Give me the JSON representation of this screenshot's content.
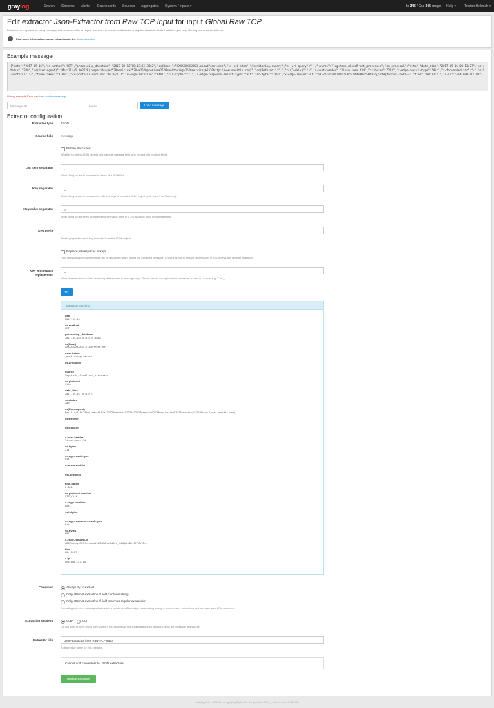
{
  "nav": {
    "logo_a": "gray",
    "logo_b": "log",
    "items": [
      "Search",
      "Streams",
      "Alerts",
      "Dashboards",
      "Sources",
      "Aggregates",
      "System / Inputs ▾"
    ],
    "throughput_prefix": "In",
    "throughput_in": "345",
    "throughput_mid": "/ Out",
    "throughput_out": "345",
    "throughput_unit": "msg/s",
    "help": "Help ▾",
    "user": "Tristan Helmich ▾"
  },
  "header": {
    "title_prefix": "Edit extractor ",
    "title_extractor": "Json-Extractor from Raw TCP Input",
    "title_mid": " for input ",
    "title_input": "Global Raw TCP",
    "subtitle": "Extractors are applied on every message that is received by an input. Use them to extract and transform any text data into fields that allow you easy filtering and analysis later on.",
    "info_bold": "Find more information about extractors in the ",
    "info_link": "documentation",
    "info_end": "."
  },
  "example": {
    "heading": "Example message",
    "message": "{\"date\":\"2017-09-16\",\"cs-method\":\"GET\",\"processing_datetime\":\"2017-09-16T08:13:55.386Z\",\"cs(Host)\":\"XXXXXXXXXXXXX.cloudfront.net\",\"cs-uri-stem\":\"/monitoring.canary\",\"cs-uri-query\":\"-\",\"source\":\"logstash_cloudfront_processor\",\"cs-protocol\":\"http\",\"date_time\":\"2017-09-16 08:13:27\",\"sc-status\":\"200\",\"cs(User-Agent)\":\"Mozilla/5.0%2520(compatible;%2520monitis%2520-%2520premium%2520monitoring%2520service;%2520http://www.monitis.com)\",\"cs(Referer)\":\"-\",\"cs(Cookie)\":\"-\",\"x-host-header\":\"linux.some.tld\",\"cs-bytes\":\"214\",\"x-edge-result-type\":\"Hit\",\"x-forwarded-for\":\"-\",\"ssl-protocol\":\"-\",\"time-taken\":\"0.001\",\"cs-protocol-version\":\"HTTP/1.1\",\"x-edge-location\":\"LAX1\",\"ssl-cipher\":\"-\",\"x-edge-response-result-type\":\"Hit\",\"sc-bytes\":\"601\",\"x-edge-request-id\":\"mB3Zhsscy0S2Ntn2nArol9bMuRNZrvRdAzq_S4YHptvDYvJF7CwYQ==\",\"time\":\"08:13:27\",\"c-ip\":\"AAA.BBB.CCC.DD\"}",
    "wrong_text": "Wrong example? You can ",
    "wrong_link": "load another message",
    "wrong_end": ".",
    "message_id_placeholder": "Message ID",
    "index_placeholder": "Index",
    "load_button": "Load message"
  },
  "config": {
    "heading": "Extractor configuration",
    "labels": {
      "type": "Extractor type",
      "source": "Source field",
      "list_sep": "List item separator",
      "key_sep": "Key separator",
      "kv_sep": "Key/value separator",
      "prefix": "Key prefix",
      "ws_repl_1": "Key whitespace",
      "ws_repl_2": "replacement",
      "condition": "Condition",
      "strategy": "Extraction strategy",
      "title": "Extractor title"
    },
    "type_value": "JSON",
    "source_value": "message",
    "flatten_label": "Flatten structures",
    "flatten_help": "Whether to flatten JSON objects into a single message field or to expand into multiple fields.",
    "list_sep_value": ", ",
    "list_sep_help": "What string to use to concatenate items of a JSON list.",
    "key_sep_value": "_",
    "key_sep_help": "What string to use to concatenate different keys of a nested JSON object (only used if not flattened).",
    "kv_sep_value": "=",
    "kv_sep_help": "What string to use when concatenating key/value pairs of a JSON object (only used if flattened).",
    "prefix_value": "",
    "prefix_help": "Text to prepend to each key extracted from the JSON object.",
    "replace_ws_label": "Replace whitespaces in keys",
    "replace_ws_help": "Field keys containing whitespaces will be discarded when storing the extracted message. Check this box to replace whitespaces in JSON keys with another character.",
    "ws_repl_value": "_",
    "ws_repl_help": "What character to use when replacing whitespaces in message keys. Please ensure the replacement character is valid in Lucene, e.g. '-' or '_'.",
    "try_button": "Try",
    "preview_heading": "Extractor preview",
    "preview": [
      {
        "k": "date",
        "v": "2017-09-16"
      },
      {
        "k": "cs-method",
        "v": "GET"
      },
      {
        "k": "processing_datetime",
        "v": "2017-09-16T08:13:55.386Z"
      },
      {
        "k": "cs(Host)",
        "v": "XXXXXXXXXXXXX.cloudfront.net"
      },
      {
        "k": "cs-uri-stem",
        "v": "/monitoring.canary"
      },
      {
        "k": "cs-uri-query",
        "v": "-"
      },
      {
        "k": "source",
        "v": "logstash_cloudfront_processor"
      },
      {
        "k": "cs-protocol",
        "v": "http"
      },
      {
        "k": "date_time",
        "v": "2017-09-16 08:13:27"
      },
      {
        "k": "sc-status",
        "v": "200"
      },
      {
        "k": "cs(User-Agent)",
        "v": "Mozilla/5.0%2520(compatible;%2520monitis%2520-%2520premium%2520monitoring%2520service;%2520http://www.monitis.com)"
      },
      {
        "k": "cs(Referer)",
        "v": "-"
      },
      {
        "k": "cs(Cookie)",
        "v": "-"
      },
      {
        "k": "x-host-header",
        "v": "linux.some.tld"
      },
      {
        "k": "cs-bytes",
        "v": "214"
      },
      {
        "k": "x-edge-result-type",
        "v": "Hit"
      },
      {
        "k": "x-forwarded-for",
        "v": "-"
      },
      {
        "k": "ssl-protocol",
        "v": "-"
      },
      {
        "k": "time-taken",
        "v": "0.001"
      },
      {
        "k": "cs-protocol-version",
        "v": "HTTP/1.1"
      },
      {
        "k": "x-edge-location",
        "v": "LAX1"
      },
      {
        "k": "ssl-cipher",
        "v": "-"
      },
      {
        "k": "x-edge-response-result-type",
        "v": "Hit"
      },
      {
        "k": "sc-bytes",
        "v": "601"
      },
      {
        "k": "x-edge-request-id",
        "v": "mB3Zhsscy0S2Ntn2nArol9bMuRNZrvRdAzq_S4YHptvDYvJF7CwYQ=="
      },
      {
        "k": "time",
        "v": "08:13:27"
      },
      {
        "k": "c-ip",
        "v": "AAA.BBB.CCC.DD"
      }
    ],
    "cond_always": "Always try to extract",
    "cond_contains": "Only attempt extraction if field contains string",
    "cond_regex": "Only attempt extraction if field matches regular expression",
    "cond_help": "Extracting only from messages that match a certain condition helps you avoiding wrong or unnecessary extractions and can also save CPU resources.",
    "strategy_copy": "Copy",
    "strategy_cut": "Cut",
    "strategy_help": "Do you want to copy or cut from source? You cannot use the cutting feature on standard fields like message and source.",
    "title_value": "Json-Extractor from Raw TCP Input",
    "title_help": "A descriptive name for this extractor.",
    "converters_note": "Cannot add converters to JSON extractors.",
    "update_button": "Update extractor"
  },
  "footer": "Graylog 2.3.1+9f2c6ef on graylog2 (Oracle Corporation 1.8.0_144 on Linux 4.4.0-93)",
  "colors": {
    "accent": "#1a89d7",
    "success": "#5cb85c",
    "navbar": "#1f1f1f",
    "logo_red": "#ff3633"
  }
}
